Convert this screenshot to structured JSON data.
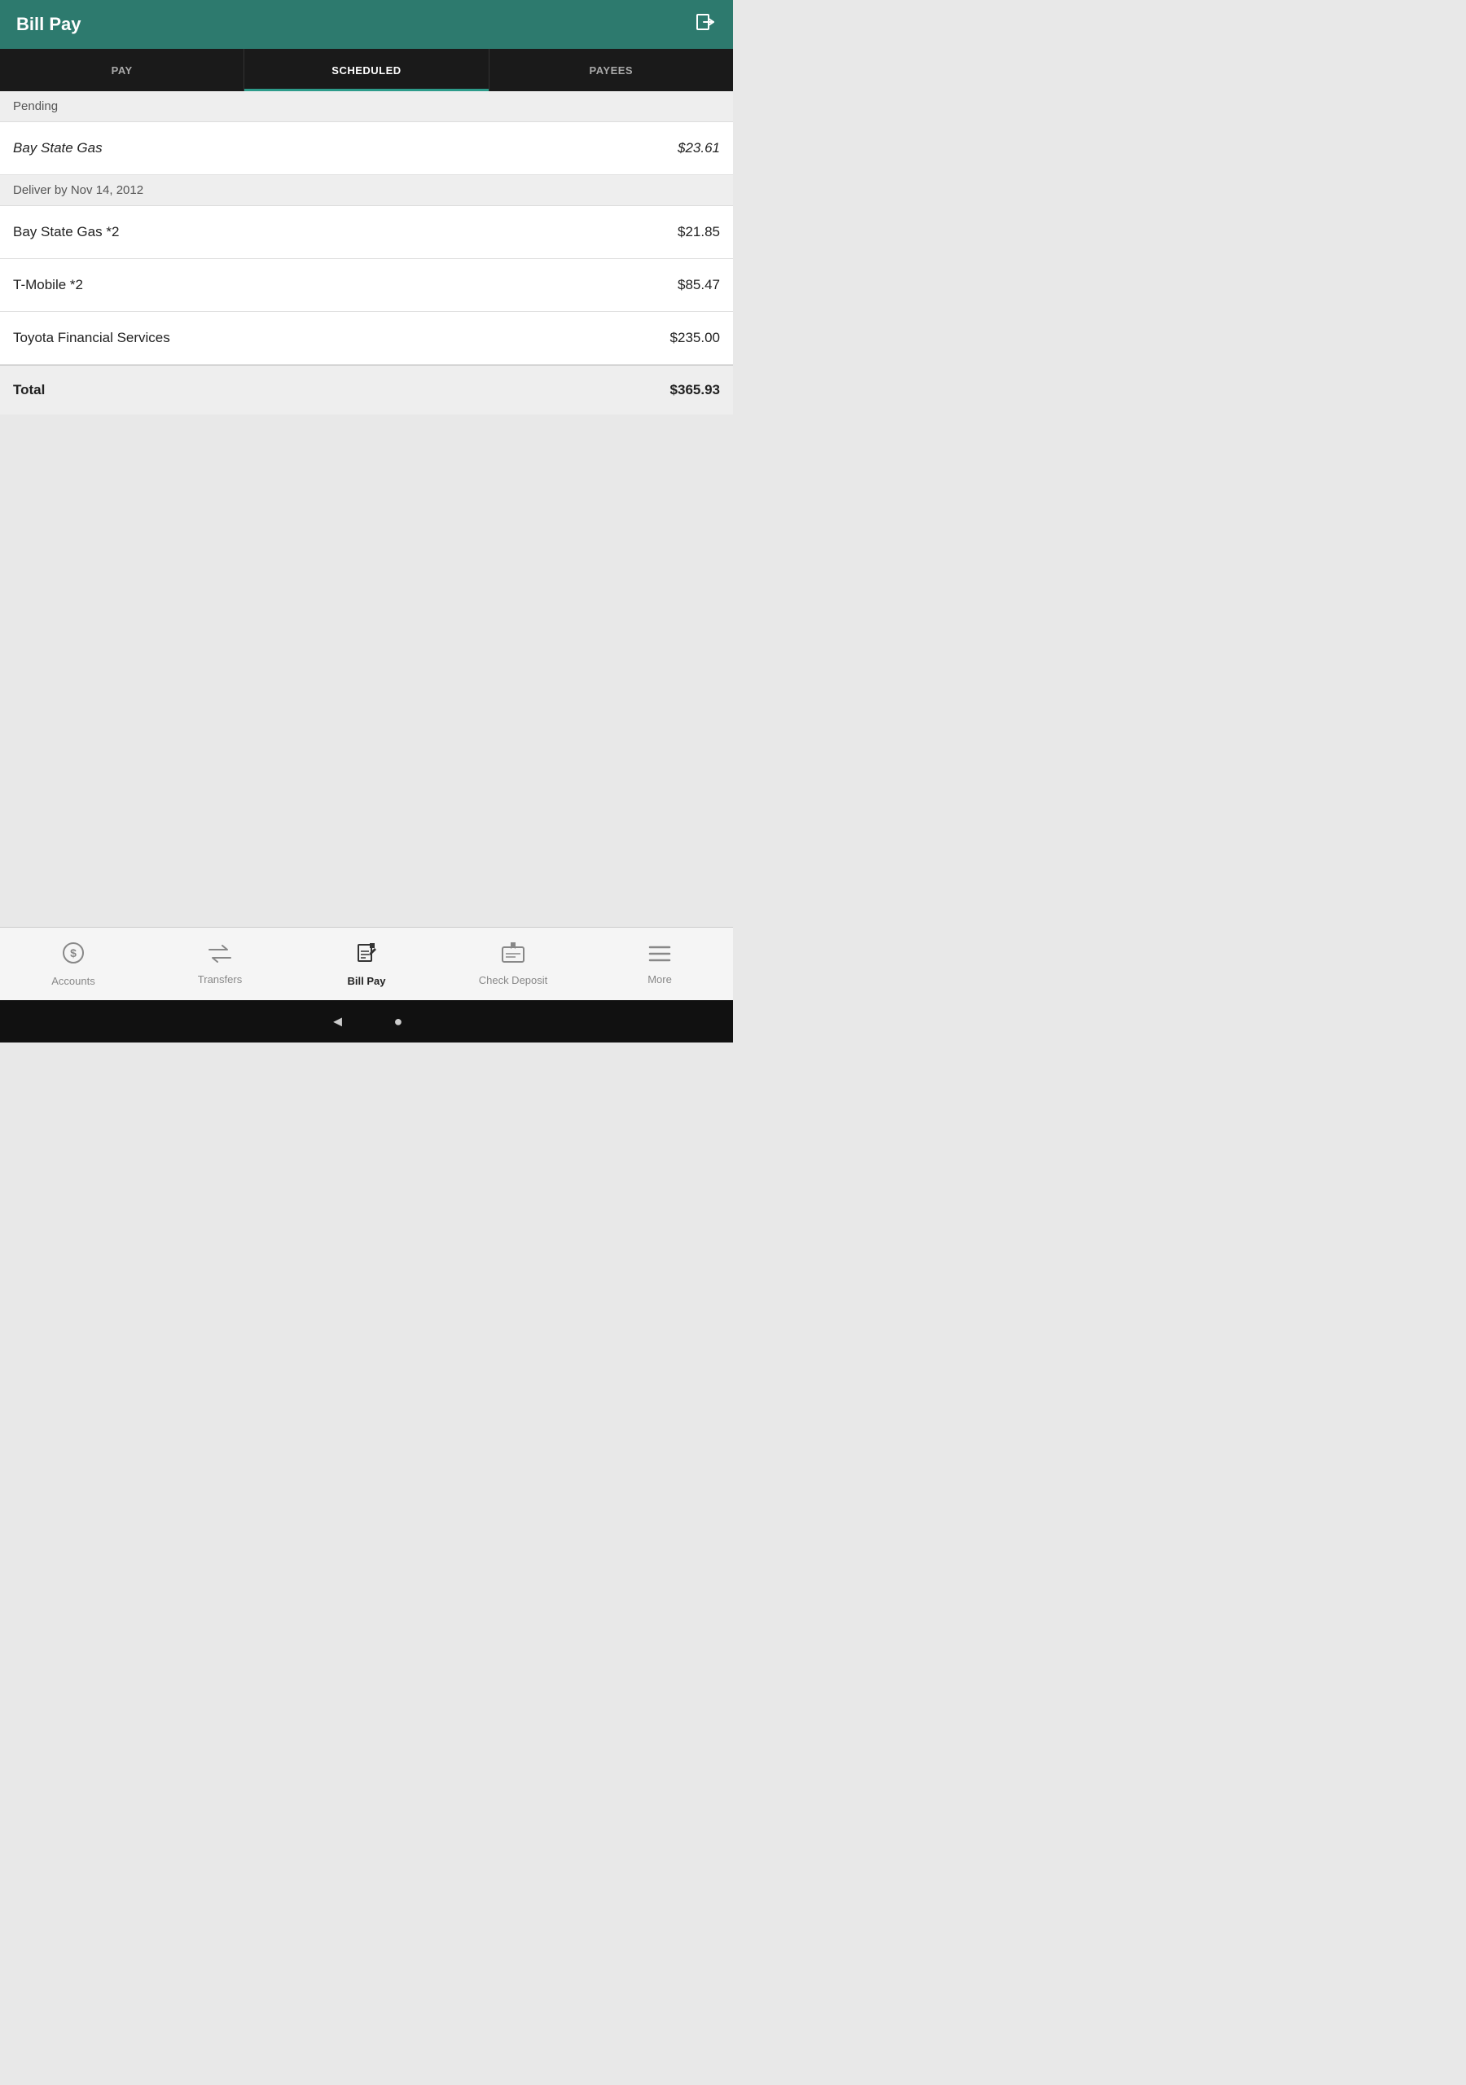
{
  "header": {
    "title": "Bill Pay",
    "icon_label": "logout-icon"
  },
  "tabs": [
    {
      "id": "pay",
      "label": "PAY",
      "active": false
    },
    {
      "id": "scheduled",
      "label": "SCHEDULED",
      "active": true
    },
    {
      "id": "payees",
      "label": "PAYEES",
      "active": false
    }
  ],
  "sections": [
    {
      "id": "pending",
      "header": "Pending",
      "items": [
        {
          "name": "Bay State Gas",
          "amount": "$23.61"
        }
      ]
    },
    {
      "id": "deliver-by",
      "header": "Deliver by Nov 14, 2012",
      "items": [
        {
          "name": "Bay State Gas *2",
          "amount": "$21.85"
        },
        {
          "name": "T-Mobile *2",
          "amount": "$85.47"
        },
        {
          "name": "Toyota Financial Services",
          "amount": "$235.00"
        }
      ]
    }
  ],
  "total": {
    "label": "Total",
    "amount": "$365.93"
  },
  "bottom_nav": [
    {
      "id": "accounts",
      "label": "Accounts",
      "icon": "accounts-icon",
      "active": false
    },
    {
      "id": "transfers",
      "label": "Transfers",
      "icon": "transfers-icon",
      "active": false
    },
    {
      "id": "billpay",
      "label": "Bill Pay",
      "icon": "billpay-icon",
      "active": true
    },
    {
      "id": "checkdeposit",
      "label": "Check Deposit",
      "icon": "checkdeposit-icon",
      "active": false
    },
    {
      "id": "more",
      "label": "More",
      "icon": "more-icon",
      "active": false
    }
  ],
  "system_bar": {
    "back_label": "◄",
    "home_label": "●"
  }
}
